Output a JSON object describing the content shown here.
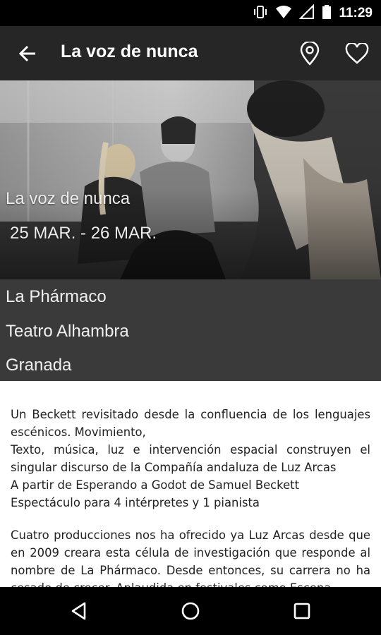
{
  "status_bar": {
    "time": "11:29",
    "icons": [
      "vibrate-icon",
      "wifi-icon",
      "signal-icon",
      "battery-icon"
    ]
  },
  "app_bar": {
    "title": "La voz de nunca",
    "back_icon": "arrow-back-icon",
    "actions": [
      "map-pin-icon",
      "heart-outline-icon"
    ]
  },
  "hero": {
    "title": "La voz de nunca",
    "dates": "25 MAR. - 26 MAR."
  },
  "info": {
    "company": "La Phármaco",
    "venue": "Teatro Alhambra",
    "city": "Granada"
  },
  "description": {
    "paragraph1_lines": [
      "Un Beckett revisitado desde la confluencia de los lenguajes escénicos. Movimiento,",
      "Texto, música, luz e intervención espacial construyen el singular discurso de la Compañía andaluza de Luz Arcas",
      "A partir de Esperando a Godot de Samuel Beckett",
      "Espectáculo para 4 intérpretes y 1 pianista"
    ],
    "paragraph2": "Cuatro producciones nos ha ofrecido ya Luz Arcas desde que en 2009 creara esta célula de investigación que responde al nombre de La Phármaco. Desde entonces, su carrera no ha cesado de crecer. Aplaudida en festivales como Escena"
  },
  "nav_bar": {
    "icons": [
      "back-triangle-icon",
      "home-circle-icon",
      "recents-square-icon"
    ]
  },
  "colors": {
    "status_bar": "#000000",
    "app_bar": "#262626",
    "info_panel": "#3a3a3a",
    "text": "#222222"
  }
}
